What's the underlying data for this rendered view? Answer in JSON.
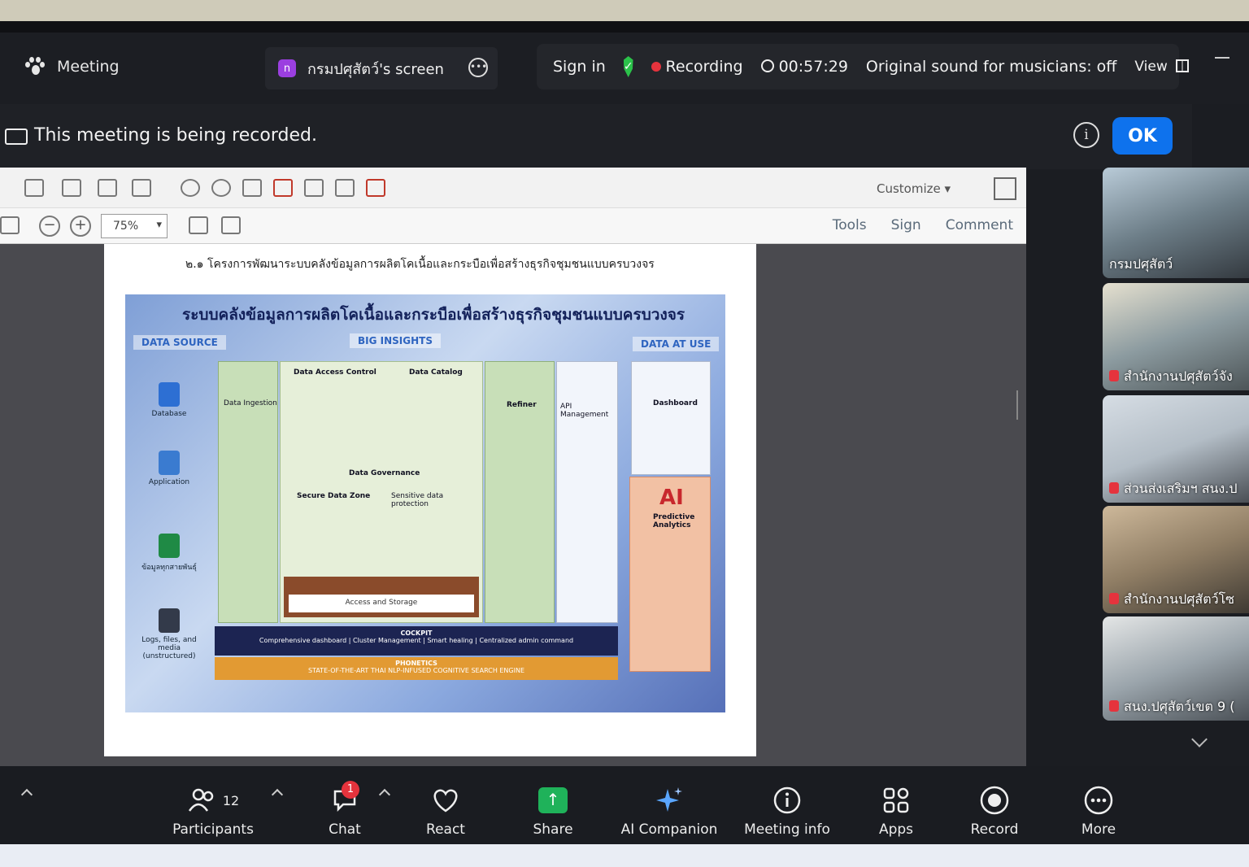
{
  "topbar": {
    "meeting_label": "Meeting",
    "share_label": "กรมปศุสัตว์'s screen",
    "share_avatar": "n",
    "sign_in": "Sign in",
    "recording": "Recording",
    "timer": "00:57:29",
    "sound": "Original sound for musicians: off",
    "view": "View"
  },
  "banner": {
    "text": "This meeting is being recorded.",
    "ok": "OK"
  },
  "viewer": {
    "zoom": "75%",
    "customize": "Customize",
    "menu": [
      "Tools",
      "Sign",
      "Comment"
    ],
    "doc_heading": "๒.๑ โครงการพัฒนาระบบคลังข้อมูลการผลิตโคเนื้อและกระบือเพื่อสร้างธุรกิจชุมชนแบบครบวงจร",
    "slide": {
      "title": "ระบบคลังข้อมูลการผลิตโคเนื้อและกระบือเพื่อสร้างธุรกิจชุมชนแบบครบวงจร",
      "data_source": "DATA SOURCE",
      "big_insights": "BIG INSIGHTS",
      "data_at_use": "DATA AT USE",
      "sources": [
        "Database",
        "Application",
        "ข้อมูลทุกสายพันธุ์",
        "Logs, files, and media (unstructured)"
      ],
      "data_ingestion": "Data Ingestion",
      "data_access_control": "Data Access Control",
      "data_catalog": "Data Catalog",
      "data_governance": "Data Governance",
      "secure_data_zone": "Secure Data Zone",
      "sensitive_data": "Sensitive data protection",
      "access_storage": "Access and Storage",
      "refiner": "Refiner",
      "api_management": "API Management",
      "dashboard": "Dashboard",
      "ai": "AI",
      "predictive": "Predictive Analytics",
      "cockpit_title": "COCKPIT",
      "cockpit_sub": "Comprehensive dashboard  |  Cluster Management  |  Smart healing  |  Centralized admin command",
      "phonetics_title": "PHONETICS",
      "phonetics_sub": "STATE-OF-THE-ART THAI NLP-INFUSED COGNITIVE SEARCH ENGINE"
    }
  },
  "gallery": [
    {
      "name": "กรมปศุสัตว์",
      "muted": false
    },
    {
      "name": "สำนักงานปศุสัตว์จัง",
      "muted": true
    },
    {
      "name": "ส่วนส่งเสริมฯ สนง.ป",
      "muted": true
    },
    {
      "name": "สำนักงานปศุสัตว์โซ",
      "muted": true
    },
    {
      "name": "สนง.ปศุสัตว์เขต 9 (",
      "muted": true
    }
  ],
  "bottombar": {
    "participants_label": "Participants",
    "participants_count": "12",
    "chat": "Chat",
    "chat_badge": "1",
    "react": "React",
    "share": "Share",
    "ai_companion": "AI Companion",
    "meeting_info": "Meeting info",
    "apps": "Apps",
    "record": "Record",
    "more": "More"
  },
  "colors": {
    "ok_blue": "#0e72ed",
    "share_green": "#1fb25a",
    "recording_red": "#e5333d",
    "shield_green": "#2bc24a"
  },
  "icons": [
    "paw-icon",
    "shield-check-icon",
    "clock-icon",
    "view-grid-icon",
    "camera-icon",
    "info-icon",
    "participants-icon",
    "chat-icon",
    "heart-icon",
    "share-arrow-icon",
    "sparkle-icon",
    "apps-icon",
    "record-icon",
    "more-icon"
  ]
}
